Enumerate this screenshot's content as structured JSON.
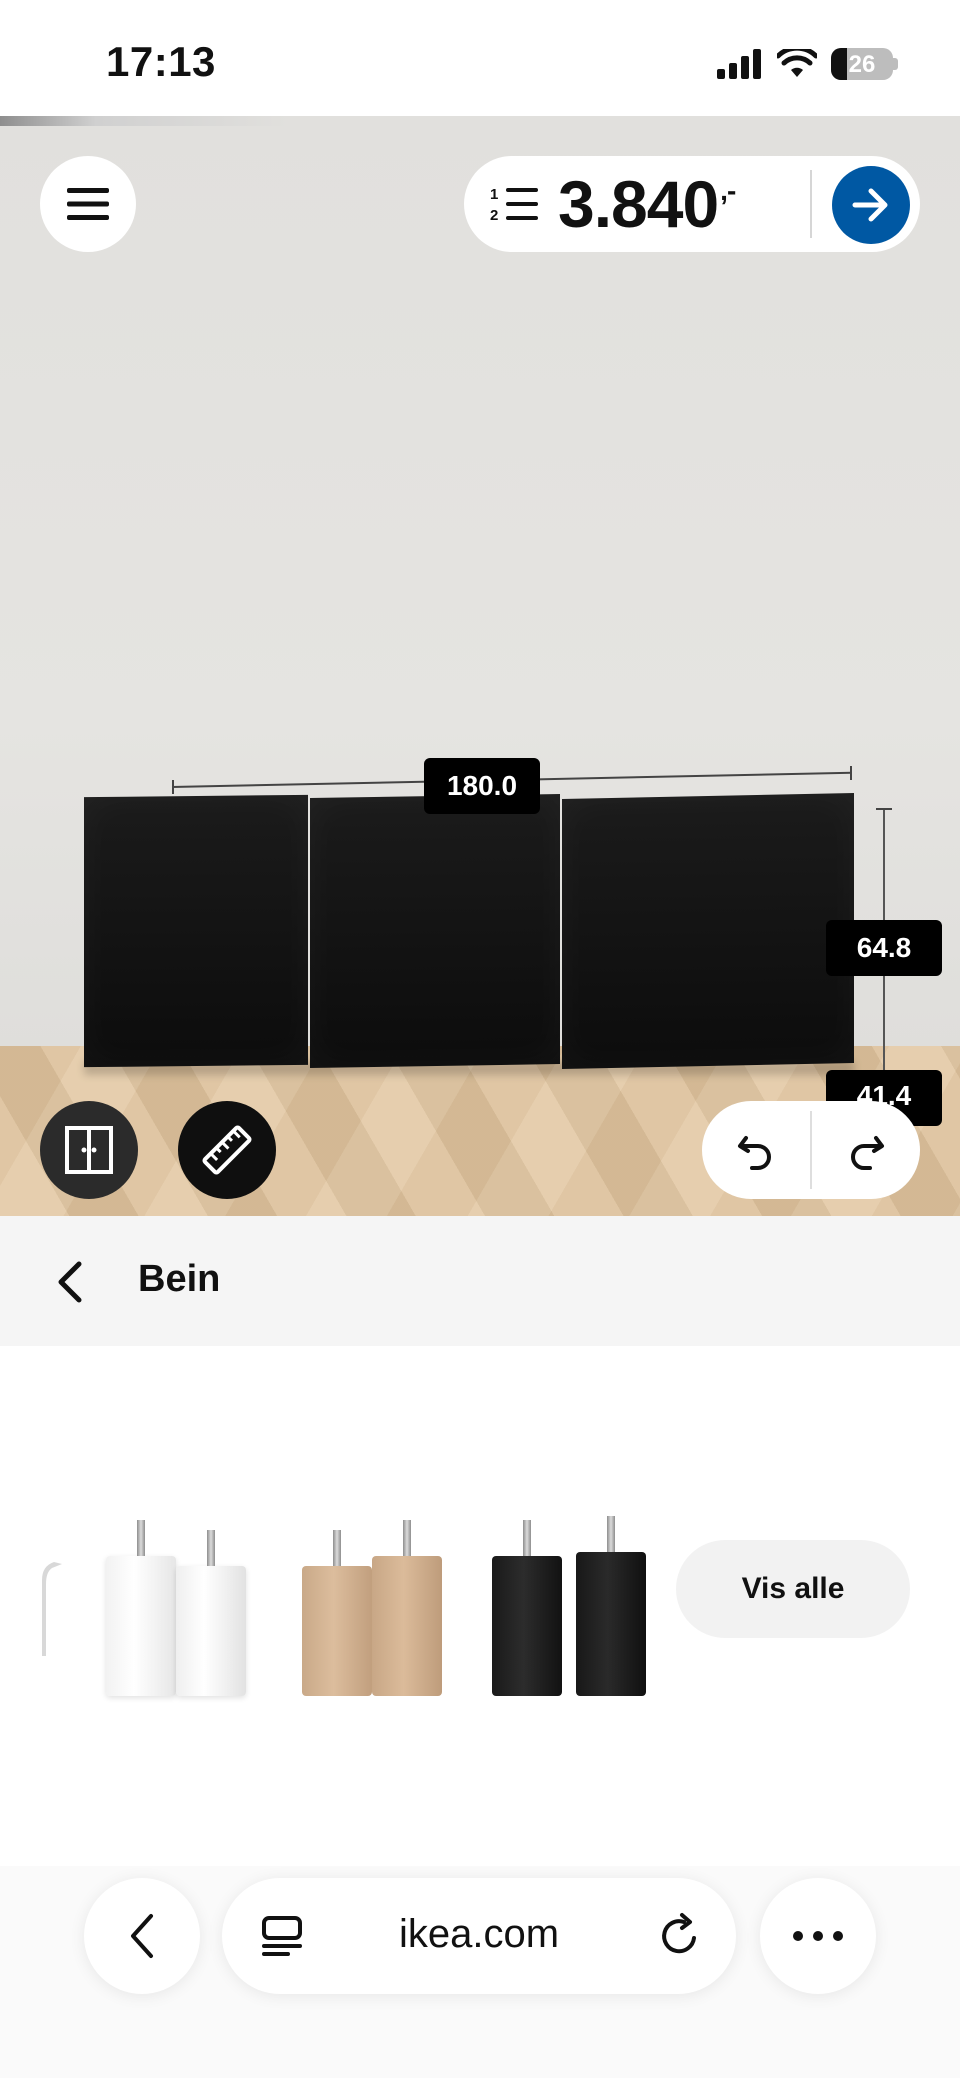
{
  "status_bar": {
    "time": "17:13",
    "battery": "26"
  },
  "planner": {
    "price": "3.840",
    "price_suffix": ",-",
    "dimensions": {
      "width": "180.0",
      "height": "64.8",
      "depth": "41.4"
    }
  },
  "category": {
    "title": "Bein"
  },
  "products": {
    "view_all_label": "Vis alle"
  },
  "browser": {
    "url": "ikea.com"
  },
  "colors": {
    "accent": "#0058a3",
    "cabinet": "#111111",
    "wall": "#e3e2df",
    "floor": "#dcc09a"
  },
  "icons": [
    "signal-icon",
    "wifi-icon",
    "battery-icon",
    "menu-icon",
    "list-icon",
    "arrow-right-icon",
    "doors-icon",
    "ruler-icon",
    "undo-icon",
    "redo-icon",
    "chevron-left-icon",
    "tabs-icon",
    "reload-icon",
    "more-icon"
  ]
}
